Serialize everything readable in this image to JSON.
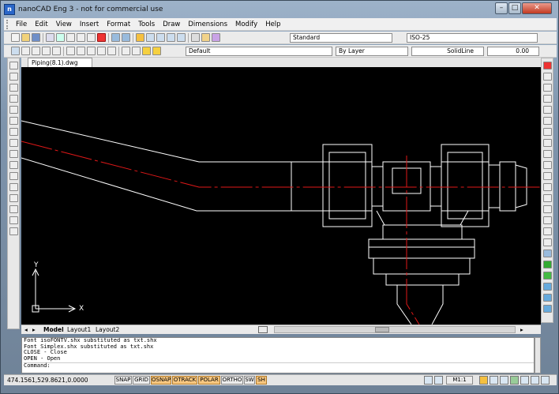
{
  "window": {
    "title": "nanoCAD Eng 3 - not for commercial use",
    "app_icon": "nanocad-app-icon",
    "controls": [
      "minimize-button",
      "maximize-button",
      "close-button"
    ]
  },
  "menu": [
    "File",
    "Edit",
    "View",
    "Insert",
    "Format",
    "Tools",
    "Draw",
    "Dimensions",
    "Modify",
    "Help"
  ],
  "toolbar": {
    "text_style": "Standard",
    "dim_style": "ISO-25",
    "layer": "Default",
    "color": "By Layer",
    "linetype": "SolidLine",
    "lineweight": "0.00"
  },
  "document_tab": "Piping(8.1).dwg",
  "layout_tabs": [
    "Model",
    "Layout1",
    "Layout2"
  ],
  "ucs": {
    "x_label": "X",
    "y_label": "Y"
  },
  "command_history": [
    "Font isoFONTV.shx substituted as txt.shx",
    "Font Simplex.shx substituted as txt.shx",
    "CLOSE - Close",
    "OPEN - Open"
  ],
  "command_prompt": "Command:",
  "status": {
    "coords": "474.1561,529.8621,0.0000",
    "toggles": [
      {
        "label": "SNAP",
        "on": false
      },
      {
        "label": "GRID",
        "on": false
      },
      {
        "label": "OSNAP",
        "on": true
      },
      {
        "label": "OTRACK",
        "on": true
      },
      {
        "label": "POLAR",
        "on": true
      },
      {
        "label": "ORTHO",
        "on": false
      },
      {
        "label": "SW",
        "on": false
      },
      {
        "label": "SH",
        "on": true
      }
    ],
    "scale": "M1:1"
  },
  "colors": {
    "canvas": "#000000",
    "geometry": "#ffffff",
    "centerline": "#e01818",
    "toggle_on": "#f8c780"
  }
}
